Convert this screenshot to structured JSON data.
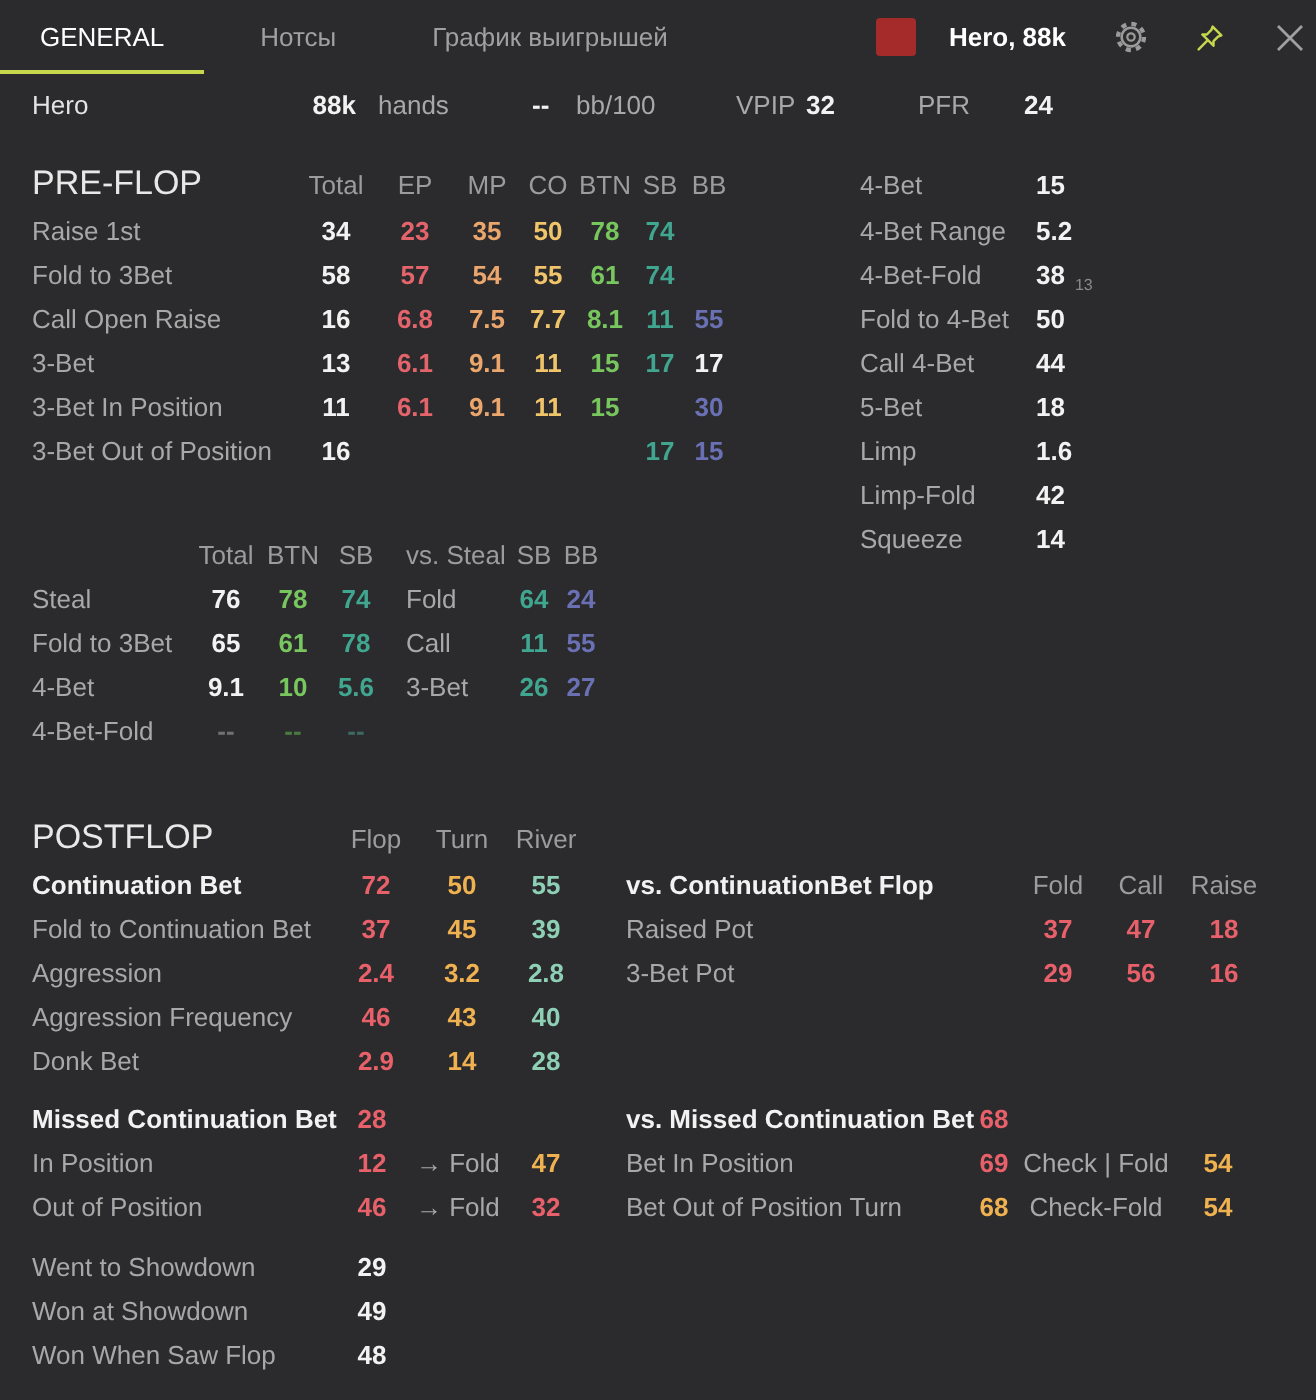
{
  "tabs": [
    {
      "label": "GENERAL",
      "selected": true
    },
    {
      "label": "Нотсы",
      "selected": false
    },
    {
      "label": "График выигрышей",
      "selected": false
    }
  ],
  "player": {
    "color": "#a52a2a",
    "name": "Hero, 88k"
  },
  "summary": {
    "name": "Hero",
    "hands": "88k",
    "hands_label": "hands",
    "winrate": "--",
    "winrate_label": "bb/100",
    "vpip_label": "VPIP",
    "vpip": "32",
    "pfr_label": "PFR",
    "pfr": "24"
  },
  "preflop": {
    "title": "PRE-FLOP",
    "columns": [
      "Total",
      "EP",
      "MP",
      "CO",
      "BTN",
      "SB",
      "BB"
    ],
    "rows": [
      {
        "label": "Raise 1st",
        "cells": [
          {
            "value": "34",
            "color": "#f2f2f2"
          },
          {
            "value": "23",
            "color": "#e4646c"
          },
          {
            "value": "35",
            "color": "#eaa66c"
          },
          {
            "value": "50",
            "color": "#f0c46a"
          },
          {
            "value": "78",
            "color": "#78c65e"
          },
          {
            "value": "74",
            "color": "#40a690"
          },
          null
        ]
      },
      {
        "label": "Fold to 3Bet",
        "cells": [
          {
            "value": "58",
            "color": "#f2f2f2"
          },
          {
            "value": "57",
            "color": "#e4646c"
          },
          {
            "value": "54",
            "color": "#eaa66c"
          },
          {
            "value": "55",
            "color": "#f0c46a"
          },
          {
            "value": "61",
            "color": "#78c65e"
          },
          {
            "value": "74",
            "color": "#40a690"
          },
          null
        ]
      },
      {
        "label": "Call Open Raise",
        "cells": [
          {
            "value": "16",
            "color": "#f2f2f2"
          },
          {
            "value": "6.8",
            "color": "#e4646c"
          },
          {
            "value": "7.5",
            "color": "#eaa66c"
          },
          {
            "value": "7.7",
            "color": "#f0c46a"
          },
          {
            "value": "8.1",
            "color": "#78c65e"
          },
          {
            "value": "11",
            "color": "#40a690"
          },
          {
            "value": "55",
            "color": "#6a70b4"
          }
        ]
      },
      {
        "label": "3-Bet",
        "cells": [
          {
            "value": "13",
            "color": "#f2f2f2"
          },
          {
            "value": "6.1",
            "color": "#e4646c"
          },
          {
            "value": "9.1",
            "color": "#eaa66c"
          },
          {
            "value": "11",
            "color": "#f0c46a"
          },
          {
            "value": "15",
            "color": "#78c65e"
          },
          {
            "value": "17",
            "color": "#40a690"
          },
          {
            "value": "17",
            "color": "#f2f2f2"
          }
        ]
      },
      {
        "label": "3-Bet In Position",
        "cells": [
          {
            "value": "11",
            "color": "#f2f2f2"
          },
          {
            "value": "6.1",
            "color": "#e4646c"
          },
          {
            "value": "9.1",
            "color": "#eaa66c"
          },
          {
            "value": "11",
            "color": "#f0c46a"
          },
          {
            "value": "15",
            "color": "#78c65e"
          },
          null,
          {
            "value": "30",
            "color": "#6a70b4"
          }
        ]
      },
      {
        "label": "3-Bet Out of Position",
        "cells": [
          {
            "value": "16",
            "color": "#f2f2f2"
          },
          null,
          null,
          null,
          null,
          {
            "value": "17",
            "color": "#40a690"
          },
          {
            "value": "15",
            "color": "#6a70b4"
          }
        ]
      }
    ]
  },
  "preflop_side": [
    {
      "label": "4-Bet",
      "value": "15"
    },
    {
      "label": "4-Bet Range",
      "value": "5.2"
    },
    {
      "label": "4-Bet-Fold",
      "value": "38",
      "sample": "13"
    },
    {
      "label": "Fold to 4-Bet",
      "value": "50"
    },
    {
      "label": "Call 4-Bet",
      "value": "44"
    },
    {
      "label": "5-Bet",
      "value": "18"
    },
    {
      "label": "Limp",
      "value": "1.6"
    },
    {
      "label": "Limp-Fold",
      "value": "42"
    },
    {
      "label": "Squeeze",
      "value": "14"
    }
  ],
  "steal": {
    "columns": [
      "Total",
      "BTN",
      "SB"
    ],
    "rows": [
      {
        "label": "Steal",
        "cells": [
          {
            "value": "76",
            "color": "#f2f2f2"
          },
          {
            "value": "78",
            "color": "#78c65e"
          },
          {
            "value": "74",
            "color": "#40a690"
          }
        ]
      },
      {
        "label": "Fold to 3Bet",
        "cells": [
          {
            "value": "65",
            "color": "#f2f2f2"
          },
          {
            "value": "61",
            "color": "#78c65e"
          },
          {
            "value": "78",
            "color": "#40a690"
          }
        ]
      },
      {
        "label": "4-Bet",
        "cells": [
          {
            "value": "9.1",
            "color": "#f2f2f2"
          },
          {
            "value": "10",
            "color": "#78c65e"
          },
          {
            "value": "5.6",
            "color": "#40a690"
          }
        ]
      },
      {
        "label": "4-Bet-Fold",
        "cells": [
          {
            "value": "--",
            "color": "#707070"
          },
          {
            "value": "--",
            "color": "#4a7a40"
          },
          {
            "value": "--",
            "color": "#3c6a60"
          }
        ]
      }
    ]
  },
  "vs_steal": {
    "title": "vs. Steal",
    "columns": [
      "SB",
      "BB"
    ],
    "rows": [
      {
        "label": "Fold",
        "cells": [
          {
            "value": "64",
            "color": "#40a690"
          },
          {
            "value": "24",
            "color": "#6a70b4"
          }
        ]
      },
      {
        "label": "Call",
        "cells": [
          {
            "value": "11",
            "color": "#40a690"
          },
          {
            "value": "55",
            "color": "#6a70b4"
          }
        ]
      },
      {
        "label": "3-Bet",
        "cells": [
          {
            "value": "26",
            "color": "#40a690"
          },
          {
            "value": "27",
            "color": "#6a70b4"
          }
        ]
      }
    ]
  },
  "postflop": {
    "title": "POSTFLOP",
    "columns": [
      "Flop",
      "Turn",
      "River"
    ],
    "rows": [
      {
        "label": "Continuation Bet",
        "bold": true,
        "cells": [
          {
            "value": "72",
            "color": "#e8606a"
          },
          {
            "value": "50",
            "color": "#f0b250"
          },
          {
            "value": "55",
            "color": "#8ed0b6"
          }
        ]
      },
      {
        "label": "Fold to Continuation Bet",
        "bold": false,
        "cells": [
          {
            "value": "37",
            "color": "#e8606a"
          },
          {
            "value": "45",
            "color": "#f0b250"
          },
          {
            "value": "39",
            "color": "#8ed0b6"
          }
        ]
      },
      {
        "label": "Aggression",
        "bold": false,
        "cells": [
          {
            "value": "2.4",
            "color": "#e8606a"
          },
          {
            "value": "3.2",
            "color": "#f0b250"
          },
          {
            "value": "2.8",
            "color": "#8ed0b6"
          }
        ]
      },
      {
        "label": "Aggression Frequency",
        "bold": false,
        "cells": [
          {
            "value": "46",
            "color": "#e8606a"
          },
          {
            "value": "43",
            "color": "#f0b250"
          },
          {
            "value": "40",
            "color": "#8ed0b6"
          }
        ]
      },
      {
        "label": "Donk Bet",
        "bold": false,
        "cells": [
          {
            "value": "2.9",
            "color": "#e8606a"
          },
          {
            "value": "14",
            "color": "#f0b250"
          },
          {
            "value": "28",
            "color": "#8ed0b6"
          }
        ]
      }
    ]
  },
  "vs_cbet": {
    "title": "vs. ContinuationBet Flop",
    "columns": [
      "Fold",
      "Call",
      "Raise"
    ],
    "rows": [
      {
        "label": "Raised Pot",
        "cells": [
          {
            "value": "37",
            "color": "#e8606a"
          },
          {
            "value": "47",
            "color": "#e8606a"
          },
          {
            "value": "18",
            "color": "#e8606a"
          }
        ]
      },
      {
        "label": "3-Bet Pot",
        "cells": [
          {
            "value": "29",
            "color": "#e8606a"
          },
          {
            "value": "56",
            "color": "#e8606a"
          },
          {
            "value": "16",
            "color": "#e8606a"
          }
        ]
      }
    ]
  },
  "missed_cbet": {
    "title": "Missed Continuation Bet",
    "value": {
      "value": "28",
      "color": "#e8606a"
    },
    "rows": [
      {
        "label": "In Position",
        "value": {
          "value": "12",
          "color": "#e8606a"
        },
        "action": "→ Fold",
        "action_value": {
          "value": "47",
          "color": "#f0b250"
        }
      },
      {
        "label": "Out of Position",
        "value": {
          "value": "46",
          "color": "#e8606a"
        },
        "action": "→ Fold",
        "action_value": {
          "value": "32",
          "color": "#e8606a"
        }
      }
    ]
  },
  "vs_missed_cbet": {
    "title": "vs. Missed Continuation Bet",
    "value": {
      "value": "68",
      "color": "#e8606a"
    },
    "rows": [
      {
        "label": "Bet In Position",
        "value": {
          "value": "69",
          "color": "#e8606a"
        },
        "action": "Check | Fold",
        "action_value": {
          "value": "54",
          "color": "#f0b250"
        }
      },
      {
        "label": "Bet Out of Position Turn",
        "value": {
          "value": "68",
          "color": "#f0b250"
        },
        "action": "Check-Fold",
        "action_value": {
          "value": "54",
          "color": "#f0b250"
        }
      }
    ]
  },
  "showdown": [
    {
      "label": "Went to Showdown",
      "value": "29"
    },
    {
      "label": "Won at Showdown",
      "value": "49"
    },
    {
      "label": "Won When Saw Flop",
      "value": "48"
    }
  ]
}
